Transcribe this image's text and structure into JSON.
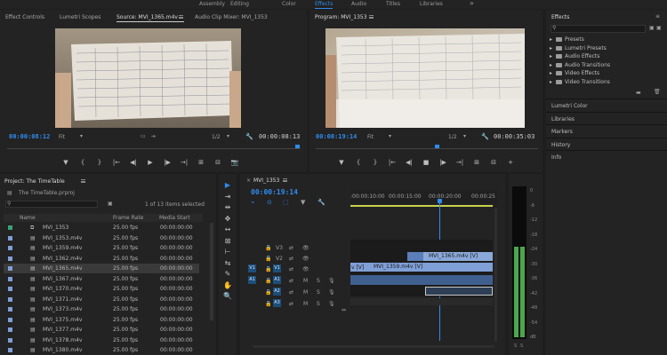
{
  "workspaces": [
    "Assembly",
    "Editing",
    "Color",
    "Effects",
    "Audio",
    "Titles",
    "Libraries"
  ],
  "workspaces_active": "Effects",
  "overflow_label": "»",
  "source_panel": {
    "tabs": [
      "Effect Controls",
      "Lumetri Scopes",
      "Source: MVI_1365.m4v",
      "Audio Clip Mixer: MVI_1353"
    ],
    "menu_icon": "hamburger-icon",
    "timecode": "00:00:08:12",
    "fit": "Fit",
    "fraction": "1/2",
    "duration": "00:00:08:13",
    "controls": [
      "▼",
      "{",
      "}",
      "|←",
      "◀|",
      "▶",
      "|▶",
      "→|",
      "⊞",
      "⊟",
      "📷"
    ]
  },
  "program_panel": {
    "title": "Program: MVI_1353",
    "timecode": "00:00:19:14",
    "fit": "Fit",
    "fraction": "1/2",
    "duration": "00:00:35:03",
    "controls": [
      "▼",
      "{",
      "}",
      "|←",
      "◀|",
      "■",
      "|▶",
      "→|",
      "⊞",
      "⊟",
      "+"
    ]
  },
  "project_panel": {
    "title": "Project: The TimeTable",
    "file": "The TimeTable.prproj",
    "selection": "1 of 13 items selected",
    "columns": [
      "Name",
      "Frame Rate",
      "Media Start"
    ],
    "items": [
      {
        "name": "MVI_1353",
        "rate": "25.00 fps",
        "start": "00:00:00:00",
        "selected": false
      },
      {
        "name": "MVI_1353.m4v",
        "rate": "25.00 fps",
        "start": "00:00:00:00",
        "selected": false
      },
      {
        "name": "MVI_1359.m4v",
        "rate": "25.00 fps",
        "start": "00:00:00:00",
        "selected": false
      },
      {
        "name": "MVI_1362.m4v",
        "rate": "25.00 fps",
        "start": "00:00:00:00",
        "selected": false
      },
      {
        "name": "MVI_1365.m4v",
        "rate": "25.00 fps",
        "start": "00:00:00:00",
        "selected": true
      },
      {
        "name": "MVI_1367.m4v",
        "rate": "25.00 fps",
        "start": "00:00:00:00",
        "selected": false
      },
      {
        "name": "MVI_1370.m4v",
        "rate": "25.00 fps",
        "start": "00:00:00:00",
        "selected": false
      },
      {
        "name": "MVI_1371.m4v",
        "rate": "25.00 fps",
        "start": "00:00:00:00",
        "selected": false
      },
      {
        "name": "MVI_1373.m4v",
        "rate": "25.00 fps",
        "start": "00:00:00:00",
        "selected": false
      },
      {
        "name": "MVI_1375.m4v",
        "rate": "25.00 fps",
        "start": "00:00:00:00",
        "selected": false
      },
      {
        "name": "MVI_1377.m4v",
        "rate": "25.00 fps",
        "start": "00:00:00:00",
        "selected": false
      },
      {
        "name": "MVI_1378.m4v",
        "rate": "25.00 fps",
        "start": "00:00:00:00",
        "selected": false
      },
      {
        "name": "MVI_1380.m4v",
        "rate": "25.00 fps",
        "start": "00:00:00:00",
        "selected": false
      }
    ]
  },
  "tools": [
    "▶",
    "⇥",
    "⇹",
    "✥",
    "↔",
    "⊠",
    "⊢",
    "⇆",
    "✎",
    "✋",
    "🔍"
  ],
  "timeline": {
    "title": "MVI_1353",
    "timecode": "00:00:19:14",
    "ruler": [
      ":00:00:10:00",
      "00:00:15:00",
      "00:00:20:00",
      "00:00:25"
    ],
    "video_tracks": [
      "V3",
      "V2",
      "V1"
    ],
    "audio_tracks": [
      "A1",
      "A2",
      "A3"
    ],
    "source_patch": {
      "v": "V1",
      "a": "A1"
    },
    "clips": {
      "v2": "MVI_1365.m4v [V]",
      "v1": "MVI_1359.m4v [V]",
      "v1_left": "v [V]"
    },
    "track_buttons": [
      "M",
      "S"
    ]
  },
  "effects_panel": {
    "title": "Effects",
    "menu": "≡",
    "tree": [
      "Presets",
      "Lumetri Presets",
      "Audio Effects",
      "Audio Transitions",
      "Video Effects",
      "Video Transitions"
    ],
    "sections": [
      "Lumetri Color",
      "Libraries",
      "Markers",
      "History",
      "Info"
    ]
  },
  "meter": {
    "scale": [
      "0",
      "-6",
      "-12",
      "-18",
      "-24",
      "-30",
      "-36",
      "-42",
      "-48",
      "-54",
      "dB"
    ],
    "channels": [
      "S",
      "S"
    ],
    "level_db": [
      -21,
      -21
    ]
  }
}
